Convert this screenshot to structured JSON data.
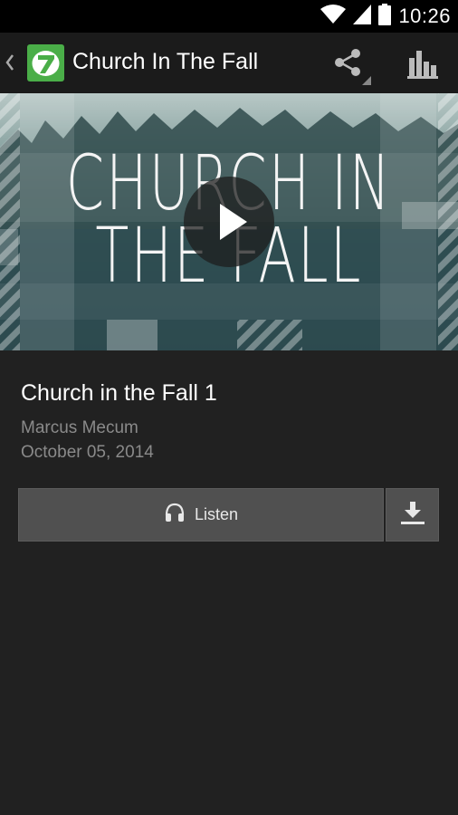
{
  "status_bar": {
    "time": "10:26"
  },
  "app_bar": {
    "title": "Church In The Fall"
  },
  "hero": {
    "line1": "CHURCH IN",
    "line2": "THE FALL"
  },
  "sermon": {
    "title": "Church in the Fall 1",
    "speaker": "Marcus Mecum",
    "date": "October 05, 2014"
  },
  "actions": {
    "listen_label": "Listen"
  },
  "colors": {
    "logo_green": "#4aae48",
    "background": "#212121",
    "button": "#505050"
  }
}
